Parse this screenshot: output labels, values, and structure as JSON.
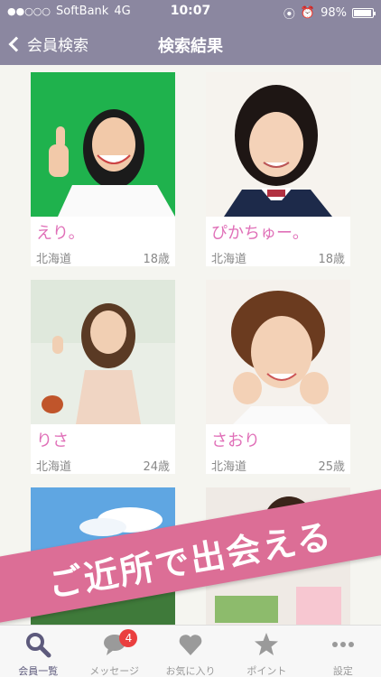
{
  "status": {
    "carrier": "SoftBank",
    "network": "4G",
    "time": "10:07",
    "battery": "98%"
  },
  "nav": {
    "back_label": "会員検索",
    "title": "検索結果"
  },
  "members": [
    {
      "name": "えり。",
      "prefecture": "北海道",
      "age": "18歳"
    },
    {
      "name": "ぴかちゅー。",
      "prefecture": "北海道",
      "age": "18歳"
    },
    {
      "name": "りさ",
      "prefecture": "北海道",
      "age": "24歳"
    },
    {
      "name": "さおり",
      "prefecture": "北海道",
      "age": "25歳"
    }
  ],
  "banner": "ご近所で出会える",
  "tabs": [
    {
      "label": "会員一覧",
      "icon": "search-icon"
    },
    {
      "label": "メッセージ",
      "icon": "chat-icon",
      "badge": "4"
    },
    {
      "label": "お気に入り",
      "icon": "heart-icon"
    },
    {
      "label": "ポイント",
      "icon": "star-icon"
    },
    {
      "label": "設定",
      "icon": "more-icon"
    }
  ],
  "colors": {
    "header": "#8b87a0",
    "name_pink": "#e070b8",
    "banner": "#dc6e96",
    "badge": "#ea3f3f"
  }
}
